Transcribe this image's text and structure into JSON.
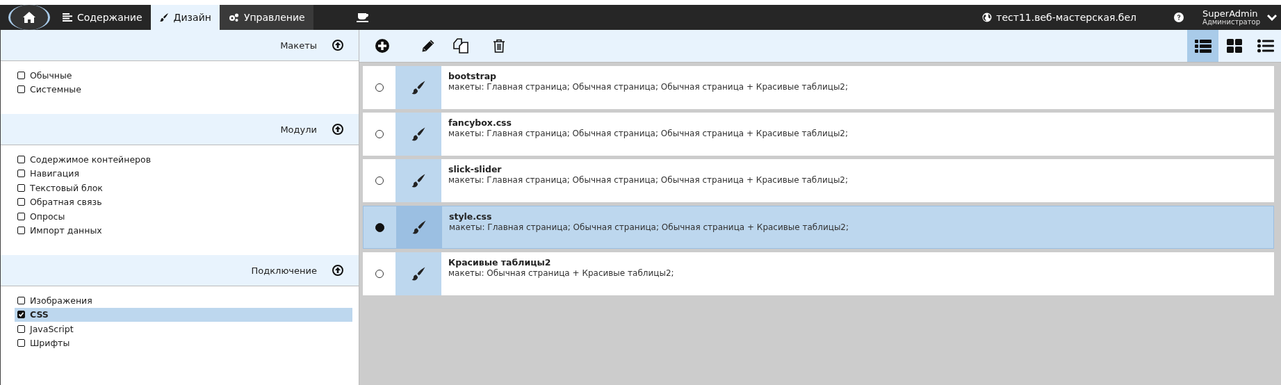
{
  "top_bar": {
    "tabs": [
      {
        "kind": "content",
        "label": "Содержание",
        "selected": false
      },
      {
        "kind": "design",
        "label": "Дизайн",
        "selected": true
      },
      {
        "kind": "manage",
        "label": "Управление",
        "selected": false
      }
    ],
    "site": "тест11.веб-мастерская.бел",
    "user": {
      "name": "SuperAdmin",
      "role": "Администратор"
    }
  },
  "sidebar": {
    "sections": [
      {
        "title": "Макеты",
        "items": [
          {
            "label": "Обычные",
            "checked": false
          },
          {
            "label": "Системные",
            "checked": false
          }
        ]
      },
      {
        "title": "Модули",
        "items": [
          {
            "label": "Содержимое контейнеров",
            "checked": false
          },
          {
            "label": "Навигация",
            "checked": false
          },
          {
            "label": "Текстовый блок",
            "checked": false
          },
          {
            "label": "Обратная связь",
            "checked": false
          },
          {
            "label": "Опросы",
            "checked": false
          },
          {
            "label": "Импорт данных",
            "checked": false
          }
        ]
      },
      {
        "title": "Подключение",
        "items": [
          {
            "label": "Изображения",
            "checked": false
          },
          {
            "label": "CSS",
            "checked": true
          },
          {
            "label": "JavaScript",
            "checked": false
          },
          {
            "label": "Шрифты",
            "checked": false
          }
        ]
      }
    ]
  },
  "toolbar": {
    "view_modes": [
      {
        "kind": "table",
        "selected": true
      },
      {
        "kind": "grid",
        "selected": false
      },
      {
        "kind": "list",
        "selected": false
      }
    ]
  },
  "rows": [
    {
      "title": "bootstrap",
      "description": "макеты: Главная страница; Обычная страница; Обычная страница + Красивые таблицы2;",
      "selected": false
    },
    {
      "title": "fancybox.css",
      "description": "макеты: Главная страница; Обычная страница; Обычная страница + Красивые таблицы2;",
      "selected": false
    },
    {
      "title": "slick-slider",
      "description": "макеты: Главная страница; Обычная страница; Обычная страница + Красивые таблицы2;",
      "selected": false
    },
    {
      "title": "style.css",
      "description": "макеты: Главная страница; Обычная страница; Обычная страница + Красивые таблицы2;",
      "selected": true
    },
    {
      "title": "Красивые таблицы2",
      "description": "макеты: Обычная страница + Красивые таблицы2;",
      "selected": false
    }
  ]
}
